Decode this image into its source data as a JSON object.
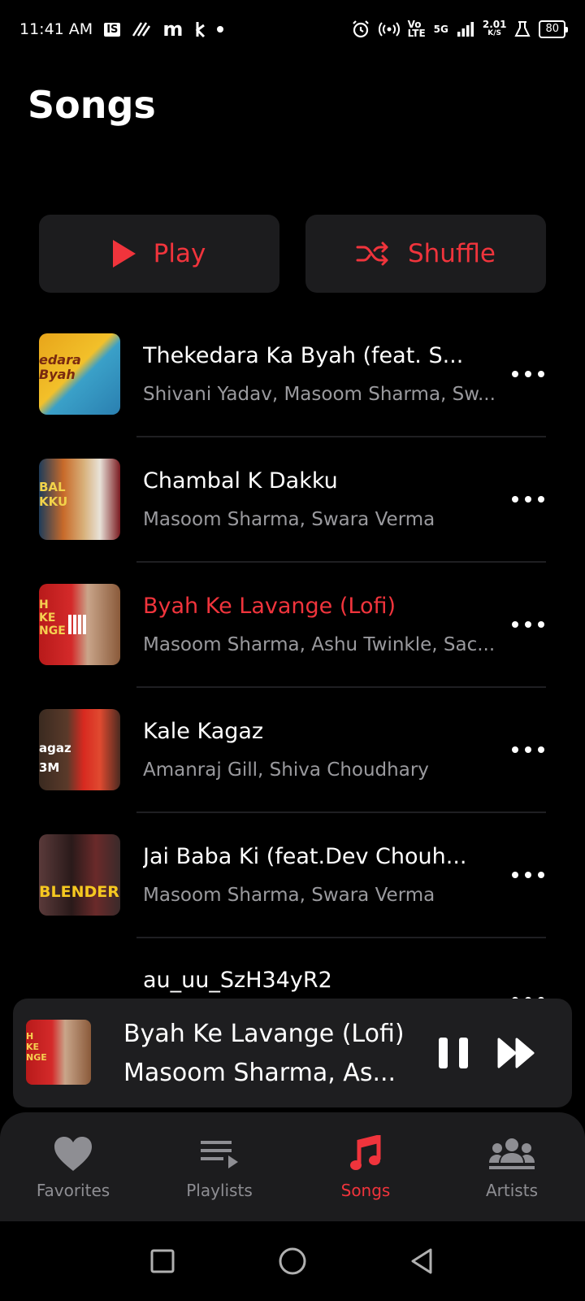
{
  "status_bar": {
    "time": "11:41 AM",
    "left_icons": [
      "IS",
      "m"
    ],
    "net_speed": "2.01",
    "net_unit": "K/S",
    "network": "5G",
    "volte": "Vo",
    "volte_sub": "LTE",
    "battery": "80"
  },
  "page": {
    "title": "Songs"
  },
  "actions": {
    "play_label": "Play",
    "shuffle_label": "Shuffle"
  },
  "colors": {
    "accent": "#f0343c",
    "background": "#000000",
    "surface": "#1c1c1e",
    "secondary_text": "#9a9a9e"
  },
  "songs": [
    {
      "title": "Thekedara Ka Byah (feat. S...",
      "artist": "Shivani Yadav, Masoom Sharma, Sw...",
      "thumb_text": "edara Byah",
      "active": false
    },
    {
      "title": "Chambal K Dakku",
      "artist": "Masoom Sharma, Swara Verma",
      "thumb_text": "BAL KKU",
      "active": false
    },
    {
      "title": "Byah Ke Lavange (Lofi)",
      "artist": "Masoom Sharma, Ashu Twinkle, Sac...",
      "thumb_text": "H KE NGE",
      "active": true
    },
    {
      "title": "Kale Kagaz",
      "artist": "Amanraj Gill, Shiva Choudhary",
      "thumb_text": "agaz 3M",
      "active": false
    },
    {
      "title": "Jai Baba Ki (feat.Dev Chouh...",
      "artist": "Masoom Sharma, Swara Verma",
      "thumb_text": "BLENDER",
      "active": false
    },
    {
      "title": "au_uu_SzH34yR2",
      "artist": "",
      "thumb_text": "",
      "active": false
    }
  ],
  "mini_player": {
    "title": "Byah Ke Lavange (Lofi)",
    "artist": "Masoom Sharma, As..."
  },
  "bottom_nav": [
    {
      "label": "Favorites",
      "icon": "heart-icon",
      "active": false
    },
    {
      "label": "Playlists",
      "icon": "playlist-icon",
      "active": false
    },
    {
      "label": "Songs",
      "icon": "music-note-icon",
      "active": true
    },
    {
      "label": "Artists",
      "icon": "artists-icon",
      "active": false
    }
  ]
}
